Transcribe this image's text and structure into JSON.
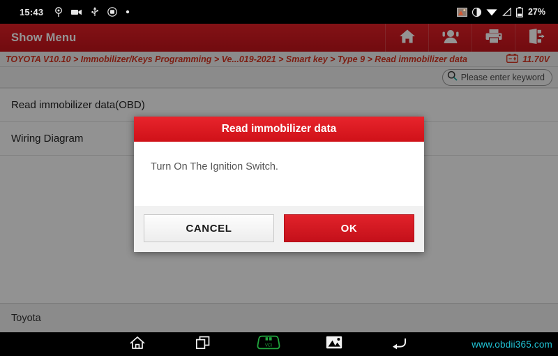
{
  "statusbar": {
    "clock": "15:43",
    "left_icons": [
      "location-icon",
      "camcorder-icon",
      "usb-icon",
      "screencast-icon",
      "dot-icon"
    ],
    "right_icons": [
      "screenshot-icon",
      "brightness-icon",
      "wifi-icon",
      "signal-icon",
      "battery-icon"
    ],
    "battery_percent": "27%"
  },
  "titlebar": {
    "title": "Show Menu",
    "actions": [
      {
        "name": "home-icon",
        "label": "Home"
      },
      {
        "name": "support-icon",
        "label": "Support"
      },
      {
        "name": "print-icon",
        "label": "Print"
      },
      {
        "name": "exit-icon",
        "label": "Exit"
      }
    ]
  },
  "breadcrumb": {
    "text": "TOYOTA V10.10 > Immobilizer/Keys Programming > Ve...019-2021 > Smart key > Type 9 > Read immobilizer data",
    "battery_icon": "car-battery-icon",
    "voltage": "11.70V"
  },
  "search": {
    "icon": "search-icon",
    "placeholder": "Please enter keyword",
    "value": ""
  },
  "menu": {
    "items": [
      {
        "label": "Read immobilizer data(OBD)"
      },
      {
        "label": "Wiring Diagram"
      }
    ]
  },
  "footer": {
    "vehicle": "Toyota"
  },
  "dialog": {
    "title": "Read immobilizer data",
    "message": "Turn On The Ignition Switch.",
    "cancel_label": "CANCEL",
    "ok_label": "OK"
  },
  "navbar": {
    "buttons": [
      {
        "name": "nav-home-icon"
      },
      {
        "name": "nav-recents-icon"
      },
      {
        "name": "nav-vci-icon",
        "label": "VCI"
      },
      {
        "name": "nav-gallery-icon"
      },
      {
        "name": "nav-back-icon"
      }
    ],
    "watermark": "www.obdii365.com"
  },
  "colors": {
    "brand_red": "#d4161d",
    "crumb_red": "#d7331f",
    "vci_green": "#21a73e",
    "watermark_cyan": "#21c4d6"
  }
}
